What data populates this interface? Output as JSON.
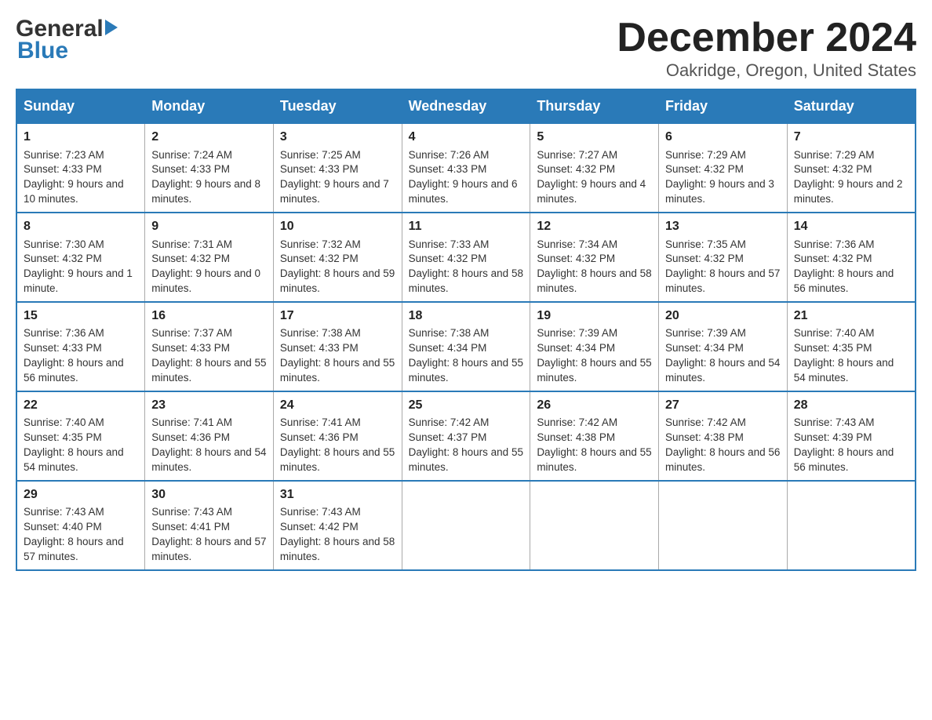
{
  "header": {
    "month_year": "December 2024",
    "location": "Oakridge, Oregon, United States",
    "logo_general": "General",
    "logo_blue": "Blue"
  },
  "days_of_week": [
    "Sunday",
    "Monday",
    "Tuesday",
    "Wednesday",
    "Thursday",
    "Friday",
    "Saturday"
  ],
  "weeks": [
    [
      {
        "day": "1",
        "sunrise": "7:23 AM",
        "sunset": "4:33 PM",
        "daylight": "9 hours and 10 minutes."
      },
      {
        "day": "2",
        "sunrise": "7:24 AM",
        "sunset": "4:33 PM",
        "daylight": "9 hours and 8 minutes."
      },
      {
        "day": "3",
        "sunrise": "7:25 AM",
        "sunset": "4:33 PM",
        "daylight": "9 hours and 7 minutes."
      },
      {
        "day": "4",
        "sunrise": "7:26 AM",
        "sunset": "4:33 PM",
        "daylight": "9 hours and 6 minutes."
      },
      {
        "day": "5",
        "sunrise": "7:27 AM",
        "sunset": "4:32 PM",
        "daylight": "9 hours and 4 minutes."
      },
      {
        "day": "6",
        "sunrise": "7:29 AM",
        "sunset": "4:32 PM",
        "daylight": "9 hours and 3 minutes."
      },
      {
        "day": "7",
        "sunrise": "7:29 AM",
        "sunset": "4:32 PM",
        "daylight": "9 hours and 2 minutes."
      }
    ],
    [
      {
        "day": "8",
        "sunrise": "7:30 AM",
        "sunset": "4:32 PM",
        "daylight": "9 hours and 1 minute."
      },
      {
        "day": "9",
        "sunrise": "7:31 AM",
        "sunset": "4:32 PM",
        "daylight": "9 hours and 0 minutes."
      },
      {
        "day": "10",
        "sunrise": "7:32 AM",
        "sunset": "4:32 PM",
        "daylight": "8 hours and 59 minutes."
      },
      {
        "day": "11",
        "sunrise": "7:33 AM",
        "sunset": "4:32 PM",
        "daylight": "8 hours and 58 minutes."
      },
      {
        "day": "12",
        "sunrise": "7:34 AM",
        "sunset": "4:32 PM",
        "daylight": "8 hours and 58 minutes."
      },
      {
        "day": "13",
        "sunrise": "7:35 AM",
        "sunset": "4:32 PM",
        "daylight": "8 hours and 57 minutes."
      },
      {
        "day": "14",
        "sunrise": "7:36 AM",
        "sunset": "4:32 PM",
        "daylight": "8 hours and 56 minutes."
      }
    ],
    [
      {
        "day": "15",
        "sunrise": "7:36 AM",
        "sunset": "4:33 PM",
        "daylight": "8 hours and 56 minutes."
      },
      {
        "day": "16",
        "sunrise": "7:37 AM",
        "sunset": "4:33 PM",
        "daylight": "8 hours and 55 minutes."
      },
      {
        "day": "17",
        "sunrise": "7:38 AM",
        "sunset": "4:33 PM",
        "daylight": "8 hours and 55 minutes."
      },
      {
        "day": "18",
        "sunrise": "7:38 AM",
        "sunset": "4:34 PM",
        "daylight": "8 hours and 55 minutes."
      },
      {
        "day": "19",
        "sunrise": "7:39 AM",
        "sunset": "4:34 PM",
        "daylight": "8 hours and 55 minutes."
      },
      {
        "day": "20",
        "sunrise": "7:39 AM",
        "sunset": "4:34 PM",
        "daylight": "8 hours and 54 minutes."
      },
      {
        "day": "21",
        "sunrise": "7:40 AM",
        "sunset": "4:35 PM",
        "daylight": "8 hours and 54 minutes."
      }
    ],
    [
      {
        "day": "22",
        "sunrise": "7:40 AM",
        "sunset": "4:35 PM",
        "daylight": "8 hours and 54 minutes."
      },
      {
        "day": "23",
        "sunrise": "7:41 AM",
        "sunset": "4:36 PM",
        "daylight": "8 hours and 54 minutes."
      },
      {
        "day": "24",
        "sunrise": "7:41 AM",
        "sunset": "4:36 PM",
        "daylight": "8 hours and 55 minutes."
      },
      {
        "day": "25",
        "sunrise": "7:42 AM",
        "sunset": "4:37 PM",
        "daylight": "8 hours and 55 minutes."
      },
      {
        "day": "26",
        "sunrise": "7:42 AM",
        "sunset": "4:38 PM",
        "daylight": "8 hours and 55 minutes."
      },
      {
        "day": "27",
        "sunrise": "7:42 AM",
        "sunset": "4:38 PM",
        "daylight": "8 hours and 56 minutes."
      },
      {
        "day": "28",
        "sunrise": "7:43 AM",
        "sunset": "4:39 PM",
        "daylight": "8 hours and 56 minutes."
      }
    ],
    [
      {
        "day": "29",
        "sunrise": "7:43 AM",
        "sunset": "4:40 PM",
        "daylight": "8 hours and 57 minutes."
      },
      {
        "day": "30",
        "sunrise": "7:43 AM",
        "sunset": "4:41 PM",
        "daylight": "8 hours and 57 minutes."
      },
      {
        "day": "31",
        "sunrise": "7:43 AM",
        "sunset": "4:42 PM",
        "daylight": "8 hours and 58 minutes."
      },
      null,
      null,
      null,
      null
    ]
  ],
  "labels": {
    "sunrise_prefix": "Sunrise: ",
    "sunset_prefix": "Sunset: ",
    "daylight_prefix": "Daylight: "
  }
}
